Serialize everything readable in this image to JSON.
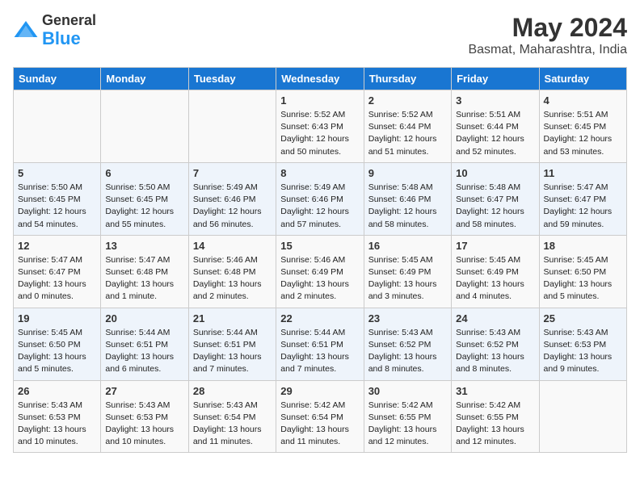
{
  "header": {
    "logo_line1": "General",
    "logo_line2": "Blue",
    "month_year": "May 2024",
    "location": "Basmat, Maharashtra, India"
  },
  "days_of_week": [
    "Sunday",
    "Monday",
    "Tuesday",
    "Wednesday",
    "Thursday",
    "Friday",
    "Saturday"
  ],
  "weeks": [
    [
      {
        "day": "",
        "info": ""
      },
      {
        "day": "",
        "info": ""
      },
      {
        "day": "",
        "info": ""
      },
      {
        "day": "1",
        "info": "Sunrise: 5:52 AM\nSunset: 6:43 PM\nDaylight: 12 hours\nand 50 minutes."
      },
      {
        "day": "2",
        "info": "Sunrise: 5:52 AM\nSunset: 6:44 PM\nDaylight: 12 hours\nand 51 minutes."
      },
      {
        "day": "3",
        "info": "Sunrise: 5:51 AM\nSunset: 6:44 PM\nDaylight: 12 hours\nand 52 minutes."
      },
      {
        "day": "4",
        "info": "Sunrise: 5:51 AM\nSunset: 6:45 PM\nDaylight: 12 hours\nand 53 minutes."
      }
    ],
    [
      {
        "day": "5",
        "info": "Sunrise: 5:50 AM\nSunset: 6:45 PM\nDaylight: 12 hours\nand 54 minutes."
      },
      {
        "day": "6",
        "info": "Sunrise: 5:50 AM\nSunset: 6:45 PM\nDaylight: 12 hours\nand 55 minutes."
      },
      {
        "day": "7",
        "info": "Sunrise: 5:49 AM\nSunset: 6:46 PM\nDaylight: 12 hours\nand 56 minutes."
      },
      {
        "day": "8",
        "info": "Sunrise: 5:49 AM\nSunset: 6:46 PM\nDaylight: 12 hours\nand 57 minutes."
      },
      {
        "day": "9",
        "info": "Sunrise: 5:48 AM\nSunset: 6:46 PM\nDaylight: 12 hours\nand 58 minutes."
      },
      {
        "day": "10",
        "info": "Sunrise: 5:48 AM\nSunset: 6:47 PM\nDaylight: 12 hours\nand 58 minutes."
      },
      {
        "day": "11",
        "info": "Sunrise: 5:47 AM\nSunset: 6:47 PM\nDaylight: 12 hours\nand 59 minutes."
      }
    ],
    [
      {
        "day": "12",
        "info": "Sunrise: 5:47 AM\nSunset: 6:47 PM\nDaylight: 13 hours\nand 0 minutes."
      },
      {
        "day": "13",
        "info": "Sunrise: 5:47 AM\nSunset: 6:48 PM\nDaylight: 13 hours\nand 1 minute."
      },
      {
        "day": "14",
        "info": "Sunrise: 5:46 AM\nSunset: 6:48 PM\nDaylight: 13 hours\nand 2 minutes."
      },
      {
        "day": "15",
        "info": "Sunrise: 5:46 AM\nSunset: 6:49 PM\nDaylight: 13 hours\nand 2 minutes."
      },
      {
        "day": "16",
        "info": "Sunrise: 5:45 AM\nSunset: 6:49 PM\nDaylight: 13 hours\nand 3 minutes."
      },
      {
        "day": "17",
        "info": "Sunrise: 5:45 AM\nSunset: 6:49 PM\nDaylight: 13 hours\nand 4 minutes."
      },
      {
        "day": "18",
        "info": "Sunrise: 5:45 AM\nSunset: 6:50 PM\nDaylight: 13 hours\nand 5 minutes."
      }
    ],
    [
      {
        "day": "19",
        "info": "Sunrise: 5:45 AM\nSunset: 6:50 PM\nDaylight: 13 hours\nand 5 minutes."
      },
      {
        "day": "20",
        "info": "Sunrise: 5:44 AM\nSunset: 6:51 PM\nDaylight: 13 hours\nand 6 minutes."
      },
      {
        "day": "21",
        "info": "Sunrise: 5:44 AM\nSunset: 6:51 PM\nDaylight: 13 hours\nand 7 minutes."
      },
      {
        "day": "22",
        "info": "Sunrise: 5:44 AM\nSunset: 6:51 PM\nDaylight: 13 hours\nand 7 minutes."
      },
      {
        "day": "23",
        "info": "Sunrise: 5:43 AM\nSunset: 6:52 PM\nDaylight: 13 hours\nand 8 minutes."
      },
      {
        "day": "24",
        "info": "Sunrise: 5:43 AM\nSunset: 6:52 PM\nDaylight: 13 hours\nand 8 minutes."
      },
      {
        "day": "25",
        "info": "Sunrise: 5:43 AM\nSunset: 6:53 PM\nDaylight: 13 hours\nand 9 minutes."
      }
    ],
    [
      {
        "day": "26",
        "info": "Sunrise: 5:43 AM\nSunset: 6:53 PM\nDaylight: 13 hours\nand 10 minutes."
      },
      {
        "day": "27",
        "info": "Sunrise: 5:43 AM\nSunset: 6:53 PM\nDaylight: 13 hours\nand 10 minutes."
      },
      {
        "day": "28",
        "info": "Sunrise: 5:43 AM\nSunset: 6:54 PM\nDaylight: 13 hours\nand 11 minutes."
      },
      {
        "day": "29",
        "info": "Sunrise: 5:42 AM\nSunset: 6:54 PM\nDaylight: 13 hours\nand 11 minutes."
      },
      {
        "day": "30",
        "info": "Sunrise: 5:42 AM\nSunset: 6:55 PM\nDaylight: 13 hours\nand 12 minutes."
      },
      {
        "day": "31",
        "info": "Sunrise: 5:42 AM\nSunset: 6:55 PM\nDaylight: 13 hours\nand 12 minutes."
      },
      {
        "day": "",
        "info": ""
      }
    ]
  ]
}
